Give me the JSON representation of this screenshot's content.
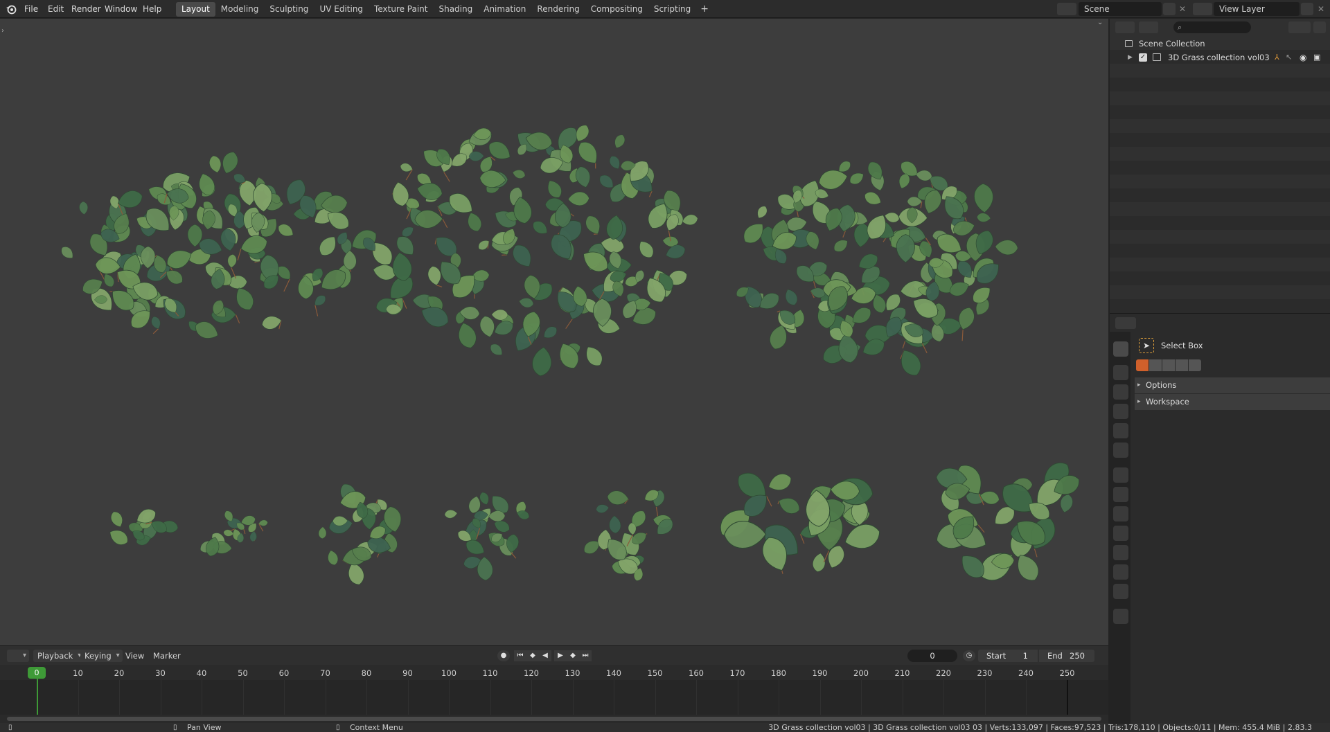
{
  "menubar": {
    "items": [
      "File",
      "Edit",
      "Render",
      "Window",
      "Help"
    ]
  },
  "workspaces": {
    "tabs": [
      "Layout",
      "Modeling",
      "Sculpting",
      "UV Editing",
      "Texture Paint",
      "Shading",
      "Animation",
      "Rendering",
      "Compositing",
      "Scripting"
    ],
    "active": "Layout",
    "add_label": "+"
  },
  "scene": {
    "scene_name": "Scene",
    "view_layer": "View Layer"
  },
  "outliner": {
    "root": "Scene Collection",
    "items": [
      {
        "label": "3D Grass collection vol03"
      }
    ]
  },
  "properties": {
    "active_tool": "Select Box",
    "panels": [
      "Options",
      "Workspace"
    ]
  },
  "timeline": {
    "menus": [
      "Playback",
      "Keying",
      "View",
      "Marker"
    ],
    "current_frame": "0",
    "start_label": "Start",
    "start_value": "1",
    "end_label": "End",
    "end_value": "250",
    "ticks": [
      "0",
      "10",
      "20",
      "30",
      "40",
      "50",
      "60",
      "70",
      "80",
      "90",
      "100",
      "110",
      "120",
      "130",
      "140",
      "150",
      "160",
      "170",
      "180",
      "190",
      "200",
      "210",
      "220",
      "230",
      "240",
      "250"
    ]
  },
  "statusbar": {
    "hint1": "Pan View",
    "hint2": "Context Menu",
    "stats": "3D Grass collection vol03 | 3D Grass collection vol03 03 | Verts:133,097 | Faces:97,523 | Tris:178,110 | Objects:0/11 | Mem: 455.4 MiB | 2.83.3"
  },
  "colors": {
    "accent": "#4772b3",
    "playhead": "#3e9a37",
    "leaf_dark": "#3f6b47",
    "leaf_light": "#7aa064"
  }
}
